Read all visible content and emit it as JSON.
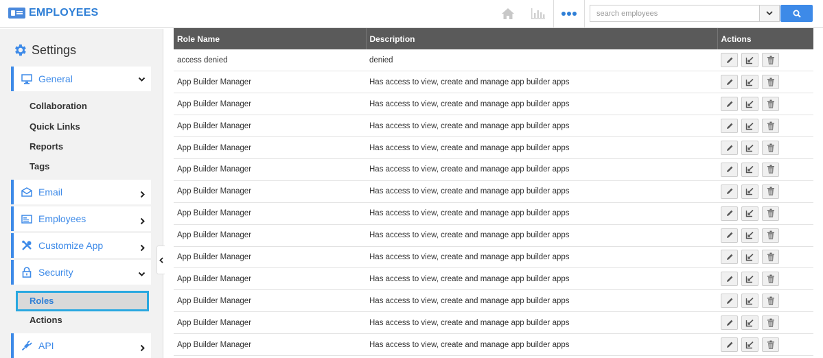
{
  "header": {
    "app_title": "EMPLOYEES",
    "icons": [
      "home-icon",
      "chart-icon",
      "more-icon"
    ],
    "search": {
      "placeholder": "search employees",
      "value": ""
    }
  },
  "sidebar": {
    "title": "Settings",
    "sections": [
      {
        "label": "General",
        "icon": "monitor-icon",
        "expanded": true,
        "items": [
          "Collaboration",
          "Quick Links",
          "Reports",
          "Tags"
        ]
      },
      {
        "label": "Email",
        "icon": "envelope-icon",
        "expanded": false
      },
      {
        "label": "Employees",
        "icon": "id-card-icon",
        "expanded": false
      },
      {
        "label": "Customize App",
        "icon": "tools-icon",
        "expanded": false
      },
      {
        "label": "Security",
        "icon": "lock-icon",
        "expanded": true,
        "items": [
          "Roles",
          "Actions"
        ],
        "active_item": "Roles"
      },
      {
        "label": "API",
        "icon": "plug-icon",
        "expanded": false
      }
    ]
  },
  "table": {
    "columns": [
      "Role Name",
      "Description",
      "Actions"
    ],
    "rows": [
      {
        "role": "access denied",
        "description": "denied"
      },
      {
        "role": "App Builder Manager",
        "description": "Has access to view, create and manage app builder apps"
      },
      {
        "role": "App Builder Manager",
        "description": "Has access to view, create and manage app builder apps"
      },
      {
        "role": "App Builder Manager",
        "description": "Has access to view, create and manage app builder apps"
      },
      {
        "role": "App Builder Manager",
        "description": "Has access to view, create and manage app builder apps"
      },
      {
        "role": "App Builder Manager",
        "description": "Has access to view, create and manage app builder apps"
      },
      {
        "role": "App Builder Manager",
        "description": "Has access to view, create and manage app builder apps"
      },
      {
        "role": "App Builder Manager",
        "description": "Has access to view, create and manage app builder apps"
      },
      {
        "role": "App Builder Manager",
        "description": "Has access to view, create and manage app builder apps"
      },
      {
        "role": "App Builder Manager",
        "description": "Has access to view, create and manage app builder apps"
      },
      {
        "role": "App Builder Manager",
        "description": "Has access to view, create and manage app builder apps"
      },
      {
        "role": "App Builder Manager",
        "description": "Has access to view, create and manage app builder apps"
      },
      {
        "role": "App Builder Manager",
        "description": "Has access to view, create and manage app builder apps"
      },
      {
        "role": "App Builder Manager",
        "description": "Has access to view, create and manage app builder apps"
      }
    ],
    "row_actions": [
      "edit-icon",
      "assign-icon",
      "delete-icon"
    ]
  },
  "colors": {
    "accent": "#3d8ae8",
    "header_bg": "#5a5a5a",
    "active_border": "#29a8e0",
    "sidebar_bg": "#f2f2f2"
  }
}
